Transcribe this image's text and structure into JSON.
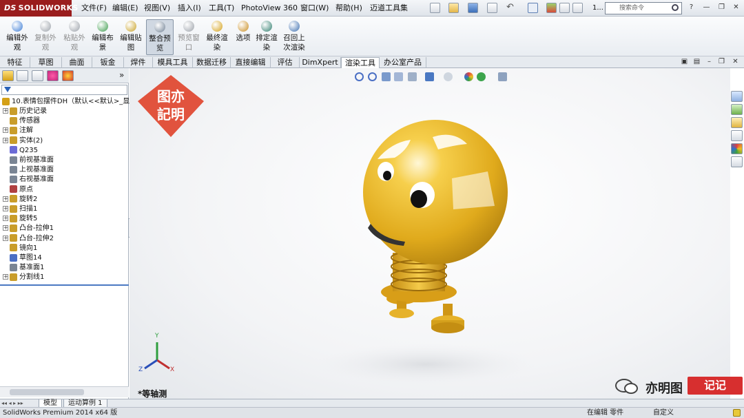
{
  "app": {
    "logo_ds": "DS",
    "logo_text": "SOLIDWORKS"
  },
  "menu": {
    "items": [
      "文件(F)",
      "编辑(E)",
      "视图(V)",
      "插入(I)",
      "工具(T)",
      "PhotoView 360",
      "窗口(W)",
      "帮助(H)",
      "迈道工具集"
    ],
    "search_placeholder": "搜索命令",
    "counter": "1..."
  },
  "commands": [
    {
      "label1": "编辑外",
      "label2": "观",
      "state": "enabled",
      "color": "#3a7bd5"
    },
    {
      "label1": "复制外",
      "label2": "观",
      "state": "disabled",
      "color": "#9aa0a8"
    },
    {
      "label1": "粘贴外",
      "label2": "观",
      "state": "disabled",
      "color": "#9aa0a8"
    },
    {
      "label1": "编辑布",
      "label2": "景",
      "state": "enabled",
      "color": "#3c9c4c"
    },
    {
      "label1": "编辑贴",
      "label2": "图",
      "state": "enabled",
      "color": "#c9a227"
    },
    {
      "label1": "整合预",
      "label2": "览",
      "state": "active",
      "color": "#6d7e92"
    },
    {
      "label1": "预览窗",
      "label2": "口",
      "state": "disabled",
      "color": "#9aa0a8"
    },
    {
      "label1": "最终渲",
      "label2": "染",
      "state": "enabled",
      "color": "#d4a017"
    },
    {
      "label1": "选项",
      "label2": "",
      "state": "enabled",
      "color": "#c98c1e"
    },
    {
      "label1": "排定渲",
      "label2": "染",
      "state": "enabled",
      "color": "#2e7d6d"
    },
    {
      "label1": "召回上",
      "label2": "次渲染",
      "state": "enabled",
      "color": "#3d6fb0"
    }
  ],
  "tabs": [
    "特征",
    "草图",
    "曲面",
    "钣金",
    "焊件",
    "模具工具",
    "数据迁移",
    "直接编辑",
    "评估",
    "DimXpert",
    "渲染工具",
    "办公室产品"
  ],
  "active_tab": "渲染工具",
  "tree": {
    "root": "10.表情包摆件DH（默认<<默认>_显示",
    "items": [
      {
        "label": "历史记录",
        "exp": true,
        "color": "#c99d2a"
      },
      {
        "label": "传感器",
        "exp": false,
        "color": "#c99d2a"
      },
      {
        "label": "注解",
        "exp": true,
        "color": "#c99d2a"
      },
      {
        "label": "实体(2)",
        "exp": true,
        "color": "#c99d2a"
      },
      {
        "label": "Q235",
        "exp": false,
        "color": "#6b6bd6"
      },
      {
        "label": "前视基准面",
        "exp": false,
        "color": "#7a8594"
      },
      {
        "label": "上视基准面",
        "exp": false,
        "color": "#7a8594"
      },
      {
        "label": "右视基准面",
        "exp": false,
        "color": "#7a8594"
      },
      {
        "label": "原点",
        "exp": false,
        "color": "#b04040"
      },
      {
        "label": "旋转2",
        "exp": true,
        "color": "#c99d2a"
      },
      {
        "label": "扫描1",
        "exp": true,
        "color": "#c99d2a"
      },
      {
        "label": "旋转5",
        "exp": true,
        "color": "#c99d2a"
      },
      {
        "label": "凸台-拉伸1",
        "exp": true,
        "color": "#c99d2a"
      },
      {
        "label": "凸台-拉伸2",
        "exp": true,
        "color": "#c99d2a"
      },
      {
        "label": "镜向1",
        "exp": false,
        "color": "#c99d2a"
      },
      {
        "label": "草图14",
        "exp": false,
        "color": "#4a6fc4"
      },
      {
        "label": "基准面1",
        "exp": false,
        "color": "#7a8594"
      },
      {
        "label": "分割线1",
        "exp": true,
        "color": "#c99d2a"
      }
    ]
  },
  "viewport": {
    "view_label": "*等轴测",
    "axis_x": "X",
    "axis_y": "Y",
    "axis_z": "Z"
  },
  "bottom_tabs": [
    "模型",
    "运动算例 1"
  ],
  "status": {
    "left": "SolidWorks Premium 2014 x64 版",
    "editing": "在编辑 零件",
    "custom": "自定义"
  },
  "watermark": {
    "stamp_text_1": "图亦",
    "stamp_text_2": "記明",
    "brand": "亦明图",
    "badge": "记记"
  },
  "colors": {
    "ball": "#f3c23a",
    "ball_dark": "#c08f12",
    "spring": "#e0a81e",
    "accent": "#9a1d1d"
  }
}
